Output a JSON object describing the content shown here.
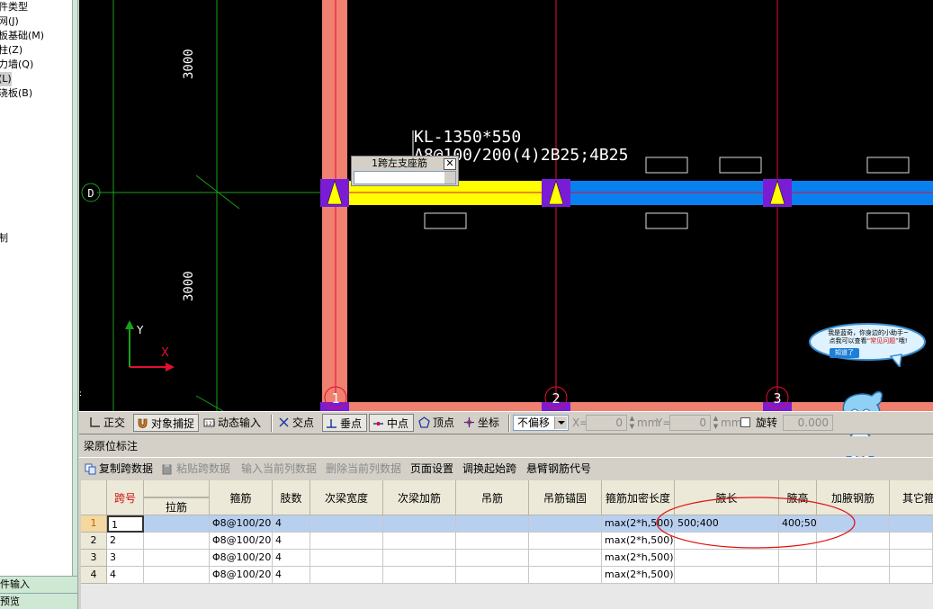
{
  "left_tree": {
    "items": [
      "件类型",
      "网(J)",
      "板基础(M)",
      "柱(Z)",
      "力墙(Q)",
      "(L)",
      "浇板(B)",
      "制"
    ],
    "selected_index": 5,
    "bottom_items": [
      "件输入",
      "预览"
    ]
  },
  "canvas": {
    "dim_top": "3000",
    "dim_bottom": "3000",
    "axis_d_label": "D",
    "axis_labels": [
      "1",
      "2",
      "3"
    ],
    "beam_label_line1": "KL-1350*550",
    "beam_label_line2": "A8@100/200(4)2B25;4B25",
    "ucs_y": "Y",
    "ucs_x": "X",
    "support_popup": {
      "title": "1跨左支座筋",
      "value": ""
    },
    "help_bubble": {
      "line1": "我是蓝奇，你身边的小助手~",
      "line2_prefix": "点我可以查看",
      "line2_highlight": "“常见问题”",
      "line2_suffix": "哦!",
      "button": "知道了"
    },
    "colors": {
      "column": "#f08070",
      "beam_selected": "#ffff00",
      "beam": "#0a7ff0",
      "node": "#7a1cd6",
      "grid_line": "#1aa01a",
      "axis_line": "#e01030"
    }
  },
  "snap_toolbar": {
    "ortho": "正交",
    "object_snap": "对象捕捉",
    "dynamic_input": "动态输入",
    "intersection": "交点",
    "perpendicular": "垂点",
    "midpoint": "中点",
    "vertex": "顶点",
    "coordinate": "坐标",
    "offset_mode": "不偏移",
    "x_label": "X=",
    "x_value": "0",
    "y_label": "Y=",
    "y_value": "0",
    "unit": "mm",
    "rotate": "旋转",
    "rotate_value": "0.000"
  },
  "panel_title": "梁原位标注",
  "actions": [
    {
      "label": "复制跨数据",
      "disabled": false
    },
    {
      "label": "粘贴跨数据",
      "disabled": true
    },
    {
      "label": "输入当前列数据",
      "disabled": true
    },
    {
      "label": "删除当前列数据",
      "disabled": true
    },
    {
      "label": "页面设置",
      "disabled": false
    },
    {
      "label": "调换起始跨",
      "disabled": false
    },
    {
      "label": "悬臂钢筋代号",
      "disabled": false
    }
  ],
  "grid": {
    "headers": {
      "span_no": "跨号",
      "tie": "拉筋",
      "stirrup": "箍筋",
      "legs": "肢数",
      "sec_beam_width": "次梁宽度",
      "sec_beam_rebar": "次梁加筋",
      "hanger": "吊筋",
      "hanger_anchor": "吊筋锚固",
      "dense_len": "箍筋加密长度",
      "haunch_len": "腋长",
      "haunch_h": "腋高",
      "haunch_rebar": "加腋钢筋",
      "other": "其它箍"
    },
    "rows": [
      {
        "row": "1",
        "span": "1",
        "tie": "",
        "stirrup": "Φ8@100/20",
        "legs": "4",
        "dense": "max(2*h,500)",
        "haunch_len": "500;400",
        "haunch_h": "400;50"
      },
      {
        "row": "2",
        "span": "2",
        "tie": "",
        "stirrup": "Φ8@100/20",
        "legs": "4",
        "dense": "max(2*h,500)",
        "haunch_len": "",
        "haunch_h": ""
      },
      {
        "row": "3",
        "span": "3",
        "tie": "",
        "stirrup": "Φ8@100/20",
        "legs": "4",
        "dense": "max(2*h,500)",
        "haunch_len": "",
        "haunch_h": ""
      },
      {
        "row": "4",
        "span": "4",
        "tie": "",
        "stirrup": "Φ8@100/20",
        "legs": "4",
        "dense": "max(2*h,500)",
        "haunch_len": "",
        "haunch_h": ""
      }
    ],
    "selected_row_color": "#b8d0f0"
  }
}
